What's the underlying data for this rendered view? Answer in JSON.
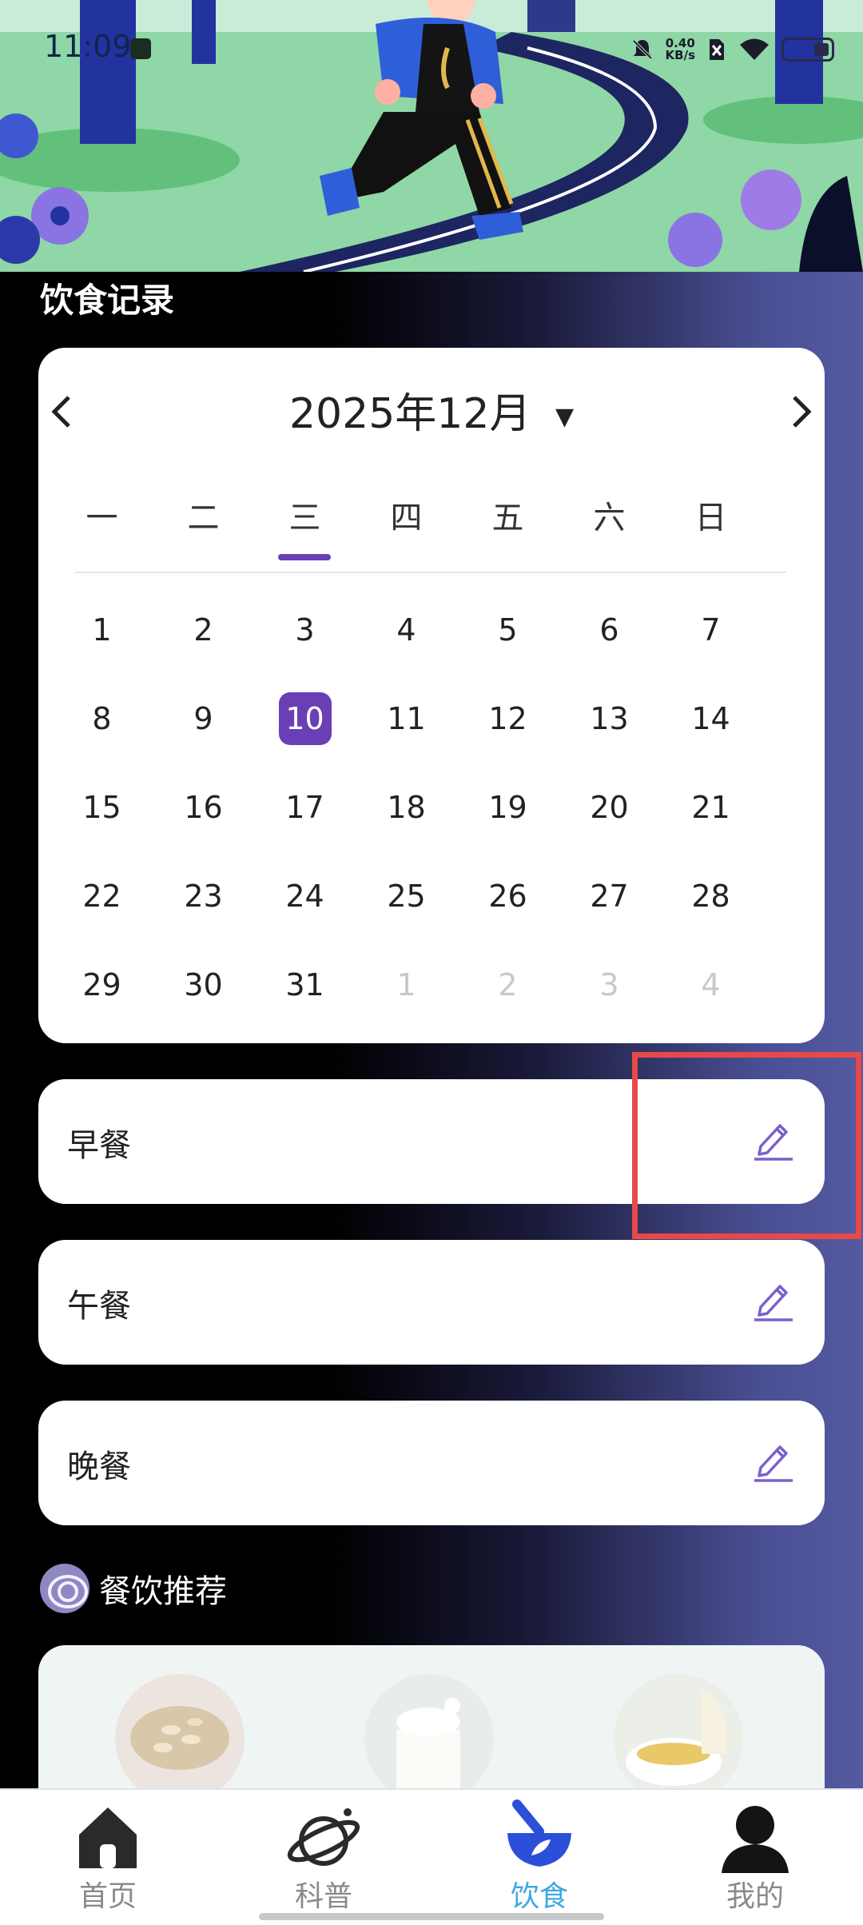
{
  "status_bar": {
    "time": "11:09",
    "net_speed_value": "0.40",
    "net_speed_unit": "KB/s"
  },
  "section_title": "饮食记录",
  "calendar": {
    "title": "2025年12月",
    "weekdays": [
      "一",
      "二",
      "三",
      "四",
      "五",
      "六",
      "日"
    ],
    "active_weekday": "三",
    "days": [
      "1",
      "2",
      "3",
      "4",
      "5",
      "6",
      "7",
      "8",
      "9",
      "10",
      "11",
      "12",
      "13",
      "14",
      "15",
      "16",
      "17",
      "18",
      "19",
      "20",
      "21",
      "22",
      "23",
      "24",
      "25",
      "26",
      "27",
      "28",
      "29",
      "30",
      "31",
      "1",
      "2",
      "3",
      "4"
    ],
    "selected_day": "10"
  },
  "meals": [
    {
      "label": "早餐",
      "icon": "edit-icon"
    },
    {
      "label": "午餐",
      "icon": "edit-icon"
    },
    {
      "label": "晚餐",
      "icon": "edit-icon"
    }
  ],
  "recommend": {
    "title": "餐饮推荐",
    "icon": "recommend-icon"
  },
  "bottom_nav": [
    {
      "label": "首页",
      "icon": "home-icon",
      "active": false
    },
    {
      "label": "科普",
      "icon": "planet-icon",
      "active": false
    },
    {
      "label": "饮食",
      "icon": "mortar-icon",
      "active": true
    },
    {
      "label": "我的",
      "icon": "user-icon",
      "active": false
    }
  ],
  "colors": {
    "accent": "#6a3fb5",
    "nav_active": "#3fa8e0",
    "highlight": "#e54a48"
  }
}
